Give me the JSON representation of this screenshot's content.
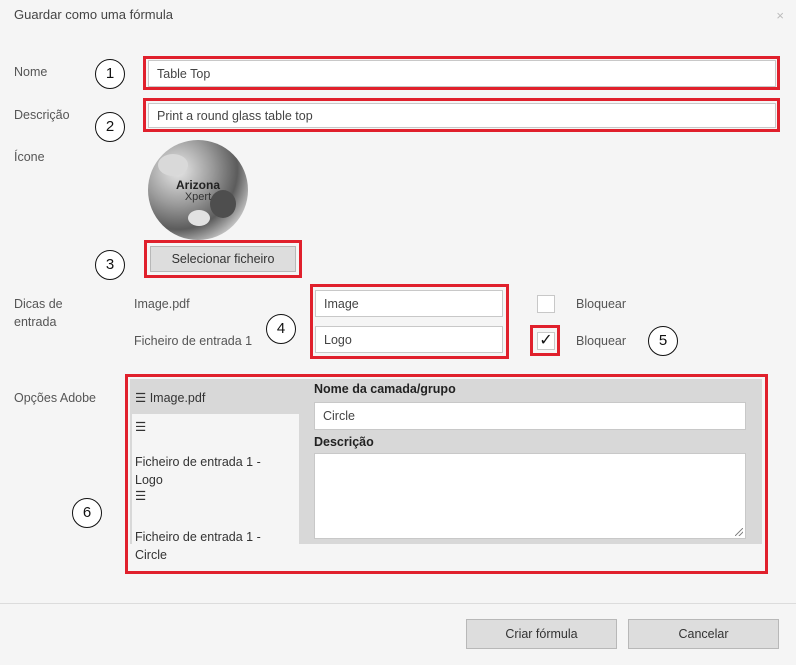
{
  "dialog": {
    "title": "Guardar como uma fórmula",
    "close_glyph": "×"
  },
  "form": {
    "name_label": "Nome",
    "name_value": "Table Top",
    "description_label": "Descrição",
    "description_value": "Print a round glass table top",
    "icon_label": "Ícone",
    "icon_text_line1": "Arizona",
    "icon_text_line2": "Xpert",
    "select_file_button": "Selecionar ficheiro"
  },
  "input_hints": {
    "label_line1": "Dicas de",
    "label_line2": "entrada",
    "rows": [
      {
        "name": "Image.pdf",
        "value": "Image",
        "lock_label": "Bloquear",
        "locked": false
      },
      {
        "name": "Ficheiro de entrada 1",
        "value": "Logo",
        "lock_label": "Bloquear",
        "locked": true
      }
    ],
    "check_glyph": "✓"
  },
  "adobe_options": {
    "label": "Opções Adobe",
    "list": [
      {
        "handle": "☰",
        "text": "Image.pdf"
      },
      {
        "handle": "☰",
        "text_line1": "Ficheiro de entrada 1 -",
        "text_line2": "Logo"
      },
      {
        "handle": "☰",
        "text_line1": "Ficheiro de entrada 1 -",
        "text_line2": "Circle"
      }
    ],
    "layer_label": "Nome da camada/grupo",
    "layer_value": "Circle",
    "desc_label": "Descrição",
    "desc_value": ""
  },
  "callouts": [
    "1",
    "2",
    "3",
    "4",
    "5",
    "6"
  ],
  "footer": {
    "create_button": "Criar fórmula",
    "cancel_button": "Cancelar"
  },
  "colors": {
    "highlight": "#e0202c",
    "background": "#f5f5f5"
  }
}
